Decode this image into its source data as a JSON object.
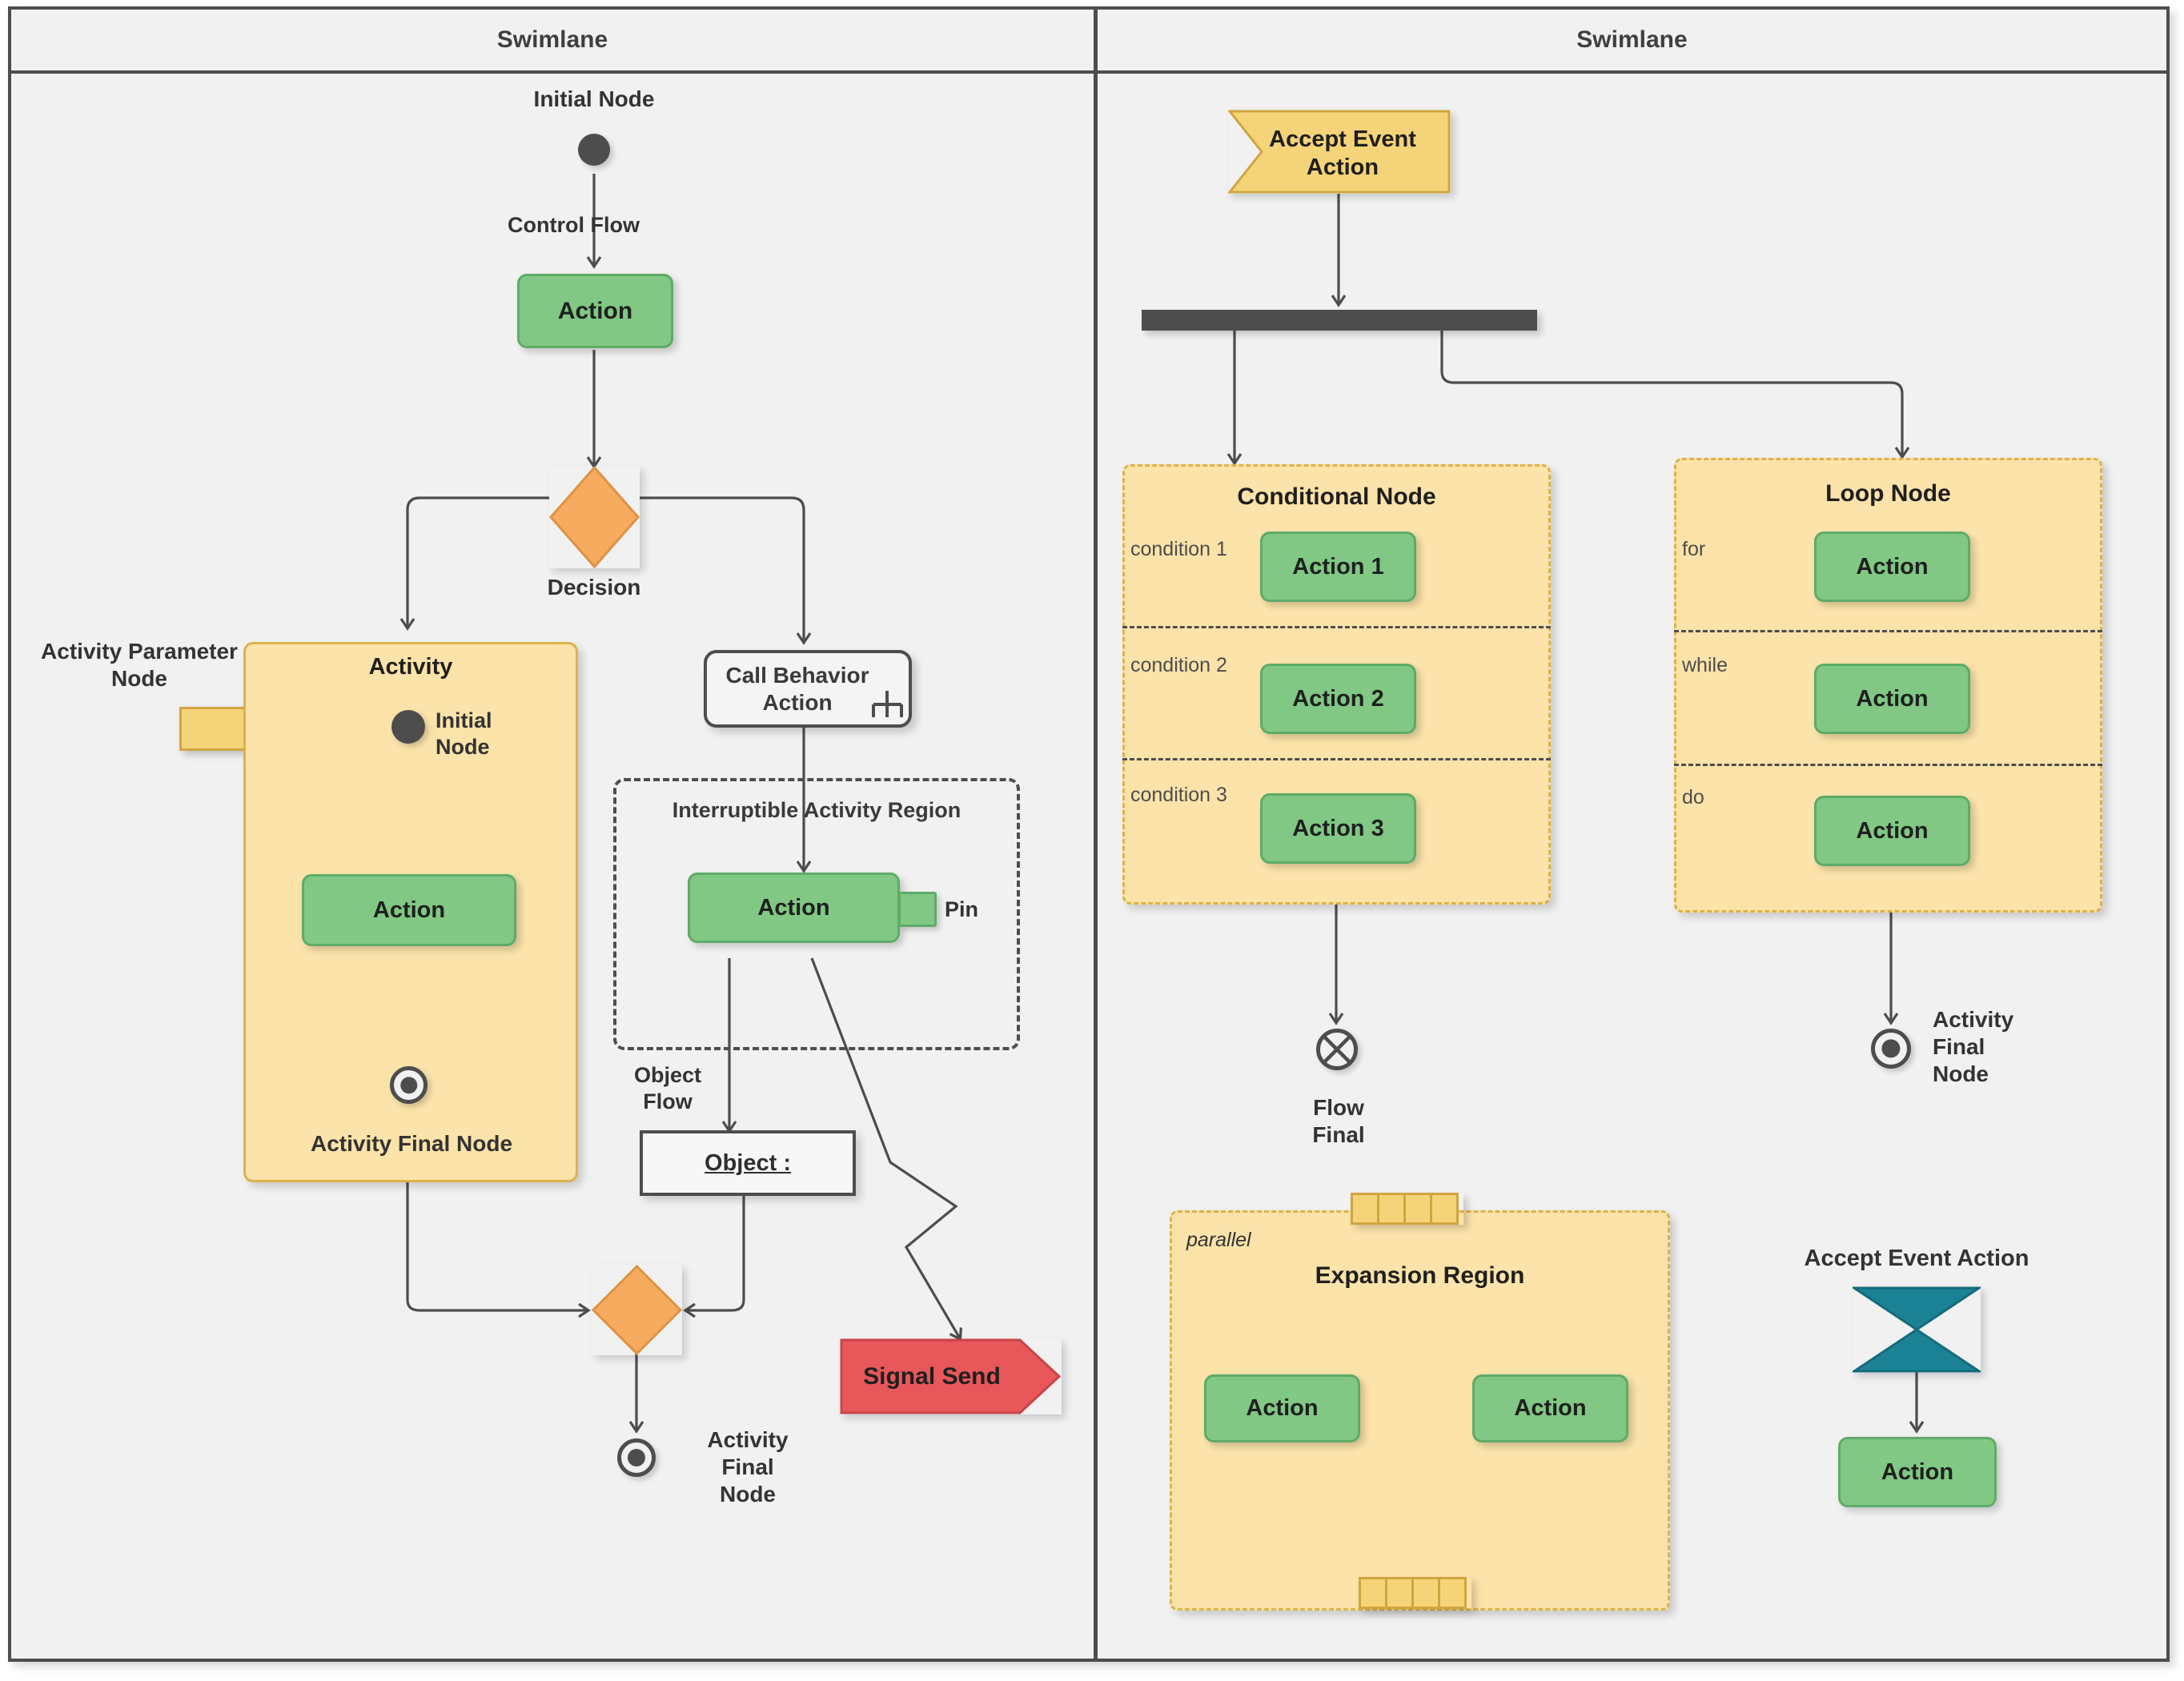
{
  "diagram": {
    "title": "UML Activity Diagram",
    "background": "#f1f1f1",
    "colors": {
      "action_fill": "#80c884",
      "action_stroke": "#5eab68",
      "region_fill": "#fbe3a9",
      "region_stroke": "#dcb24b",
      "decision_fill": "#f7ab5e",
      "decision_stroke": "#dd9244",
      "signal_fill": "#e8575a",
      "signal_stroke": "#c94447",
      "accept_event_fill": "#f5d479",
      "accept_event_stroke": "#d0a53f",
      "time_event_fill": "#1b8295",
      "line": "#4d4d4d"
    }
  },
  "lanes": [
    {
      "label": "Swimlane"
    },
    {
      "label": "Swimlane"
    }
  ],
  "left_lane": {
    "initial_node_label": "Initial Node",
    "control_flow_label": "Control Flow",
    "action_top_label": "Action",
    "decision_label": "Decision",
    "activity_parameter_node_label": "Activity Parameter\nNode",
    "activity": {
      "title": "Activity",
      "initial_node_label": "Initial\nNode",
      "action_label": "Action",
      "final_node_label": "Activity Final Node"
    },
    "call_behavior_action_label": "Call Behavior\nAction",
    "interruptible_region_label": "Interruptible Activity Region",
    "interruptible_action_label": "Action",
    "pin_label": "Pin",
    "object_flow_label": "Object\nFlow",
    "object_node_label": "Object :",
    "signal_send_label": "Signal Send",
    "final_node_label": "Activity\nFinal\nNode"
  },
  "right_lane": {
    "accept_event_action_label": "Accept Event\nAction",
    "conditional_node": {
      "title": "Conditional Node",
      "segments": [
        {
          "condition": "condition 1",
          "action": "Action 1"
        },
        {
          "condition": "condition 2",
          "action": "Action 2"
        },
        {
          "condition": "condition 3",
          "action": "Action 3"
        }
      ]
    },
    "loop_node": {
      "title": "Loop Node",
      "segments": [
        {
          "condition": "for",
          "action": "Action"
        },
        {
          "condition": "while",
          "action": "Action"
        },
        {
          "condition": "do",
          "action": "Action"
        }
      ]
    },
    "flow_final_label": "Flow\nFinal",
    "activity_final_label": "Activity\nFinal\nNode",
    "expansion_region": {
      "keyword": "parallel",
      "title": "Expansion Region",
      "action_left": "Action",
      "action_right": "Action"
    },
    "time_event": {
      "label": "Accept Event Action",
      "action_label": "Action"
    }
  }
}
